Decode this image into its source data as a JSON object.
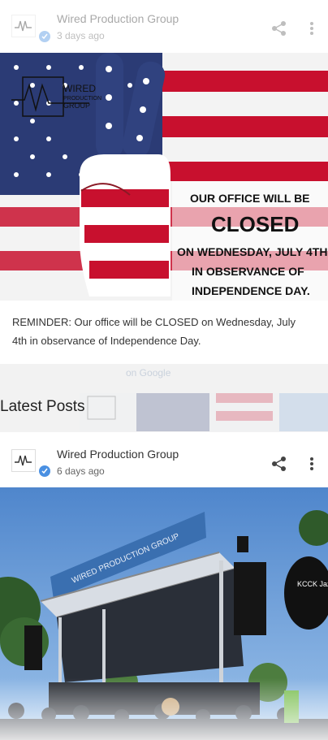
{
  "post1": {
    "author": "Wired Production Group",
    "time": "3 days ago",
    "image": {
      "logo_line1": "WIRED",
      "logo_line2": "PRODUCTION",
      "logo_line3": "GROUP",
      "text_line1": "OUR OFFICE WILL BE",
      "text_line2": "CLOSED",
      "text_line3": "ON WEDNESDAY, JULY 4TH",
      "text_line4": "IN OBSERVANCE OF",
      "text_line5": "INDEPENDENCE DAY."
    },
    "caption": "REMINDER: Our office will be CLOSED on Wednesday, July 4th in observance of Independence Day.",
    "ghost_google": "on Google"
  },
  "section": {
    "title": "Latest Posts"
  },
  "post2": {
    "author": "Wired Production Group",
    "time": "6 days ago",
    "image": {
      "banner": "WIRED PRODUCTION GROUP",
      "sign": "KCCK Jazz"
    }
  },
  "colors": {
    "flag_red": "#c8102e",
    "flag_blue": "#2b3b75",
    "verified_blue": "#4a90e2",
    "sky_blue": "#5a8fd0"
  },
  "icons": [
    "share-icon",
    "more-vert-icon",
    "verified-icon",
    "avatar-logo"
  ]
}
